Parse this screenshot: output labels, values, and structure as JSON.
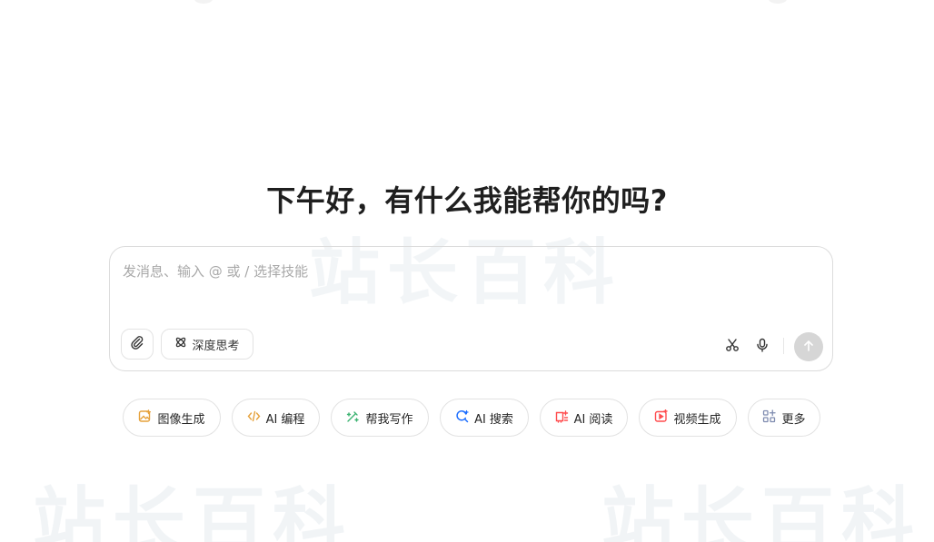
{
  "watermark": {
    "text": "站长百科"
  },
  "greeting": {
    "title": "下午好，有什么我能帮你的吗?"
  },
  "composer": {
    "placeholder": "发消息、输入 @ 或 / 选择技能",
    "value": "",
    "deep_think_label": "深度思考"
  },
  "skills": [
    {
      "label": "图像生成",
      "icon": "image-icon",
      "color": "#e6a23c"
    },
    {
      "label": "AI 编程",
      "icon": "code-icon",
      "color": "#e6a23c"
    },
    {
      "label": "帮我写作",
      "icon": "pen-icon",
      "color": "#3cb371"
    },
    {
      "label": "AI 搜索",
      "icon": "search-icon",
      "color": "#1e6fff"
    },
    {
      "label": "AI 阅读",
      "icon": "read-icon",
      "color": "#ff4d4f"
    },
    {
      "label": "视频生成",
      "icon": "video-icon",
      "color": "#ff4d4f"
    },
    {
      "label": "更多",
      "icon": "apps-icon",
      "color": "#6b7cff"
    }
  ],
  "colors": {
    "send_disabled": "#d6d6d6",
    "border": "#dcdcdc"
  }
}
